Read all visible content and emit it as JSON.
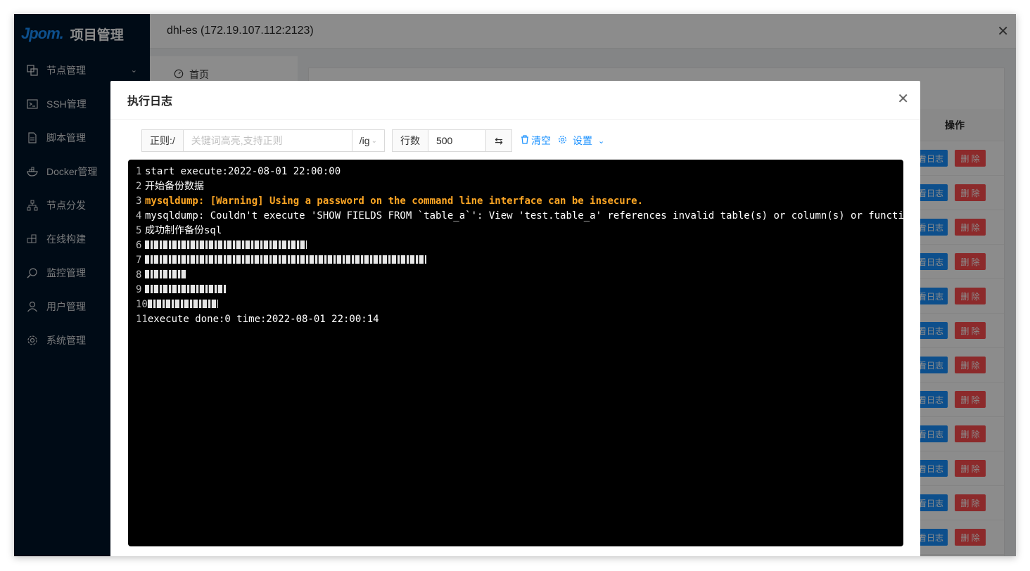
{
  "app": {
    "logo_mark": "Jpom.",
    "logo_text": "项目管理"
  },
  "sidebar": {
    "items": [
      {
        "label": "节点管理",
        "icon": "cluster-icon",
        "expanded": true
      },
      {
        "label": "SSH管理",
        "icon": "terminal-icon"
      },
      {
        "label": "脚本管理",
        "icon": "file-icon"
      },
      {
        "label": "Docker管理",
        "icon": "docker-icon"
      },
      {
        "label": "节点分发",
        "icon": "apartment-icon"
      },
      {
        "label": "在线构建",
        "icon": "build-icon"
      },
      {
        "label": "监控管理",
        "icon": "monitor-icon"
      },
      {
        "label": "用户管理",
        "icon": "user-icon"
      },
      {
        "label": "系统管理",
        "icon": "gear-icon"
      }
    ]
  },
  "drawer": {
    "title": "dhl-es (172.19.107.112:2123)",
    "home_label": "首页"
  },
  "table": {
    "ops_header": "操作",
    "view_label": "查看日志",
    "delete_label": "删 除",
    "row_count": 12
  },
  "modal": {
    "title": "执行日志",
    "regex_label": "正则:/",
    "search_placeholder": "关键词高亮,支持正则",
    "flags": "/ig",
    "rows_label": "行数",
    "rows_value": "500",
    "clear_label": "清空",
    "settings_label": "设置"
  },
  "log": [
    {
      "n": "1",
      "text": "start execute:2022-08-01 22:00:00"
    },
    {
      "n": "2",
      "text": "开始备份数据"
    },
    {
      "n": "3",
      "text": "mysqldump: [Warning] Using a password on the command line interface can be insecure.",
      "warn": true
    },
    {
      "n": "4",
      "text": "mysqldump: Couldn't execute 'SHOW FIELDS FROM `table_a`': View 'test.table_a' references invalid table(s) or column(s) or functi"
    },
    {
      "n": "5",
      "text": "成功制作备份sql"
    },
    {
      "n": "6",
      "text": "",
      "redacted": true
    },
    {
      "n": "7",
      "text": "",
      "redacted": true
    },
    {
      "n": "8",
      "text": "",
      "redacted": true
    },
    {
      "n": "9",
      "text": "",
      "redacted": true
    },
    {
      "n": "10",
      "text": "",
      "redacted": true
    },
    {
      "n": "11",
      "text": "execute done:0 time:2022-08-01 22:00:14"
    }
  ],
  "colors": {
    "accent": "#1890ff",
    "danger": "#ff4d4f",
    "warning_text": "#ffa724",
    "sidebar_bg": "#001529"
  }
}
